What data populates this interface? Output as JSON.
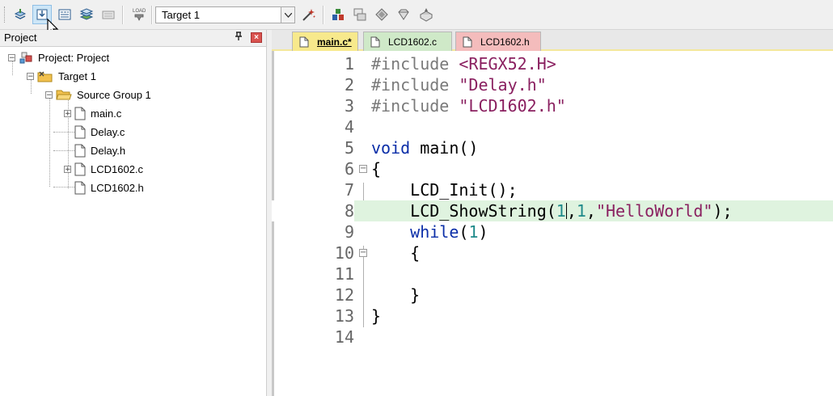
{
  "toolbar": {
    "target_value": "Target 1",
    "load_label": "LOAD"
  },
  "project_pane": {
    "title": "Project",
    "tree": {
      "project": "Project: Project",
      "target": "Target 1",
      "group": "Source Group 1",
      "files": [
        "main.c",
        "Delay.c",
        "Delay.h",
        "LCD1602.c",
        "LCD1602.h"
      ]
    }
  },
  "editor": {
    "tabs": [
      {
        "label": "main.c*",
        "active": true
      },
      {
        "label": "LCD1602.c",
        "active": false
      },
      {
        "label": "LCD1602.h",
        "active": false
      }
    ],
    "line_numbers": [
      "1",
      "2",
      "3",
      "4",
      "5",
      "6",
      "7",
      "8",
      "9",
      "10",
      "11",
      "12",
      "13",
      "14"
    ],
    "code": {
      "l1a": "#include ",
      "l1b": "<REGX52.H>",
      "l2a": "#include ",
      "l2b": "\"Delay.h\"",
      "l3a": "#include ",
      "l3b": "\"LCD1602.h\"",
      "l5a": "void",
      "l5b": " main()",
      "l6": "{",
      "l7": "    LCD_Init();",
      "l8a": "    LCD_ShowString(",
      "l8b": "1",
      "l8c": ",",
      "l8d": "1",
      "l8e": ",",
      "l8f": "\"HelloWorld\"",
      "l8g": ");",
      "l9a": "    ",
      "l9b": "while",
      "l9c": "(",
      "l9d": "1",
      "l9e": ")",
      "l10": "    {",
      "l12": "    }",
      "l13": "}"
    }
  }
}
